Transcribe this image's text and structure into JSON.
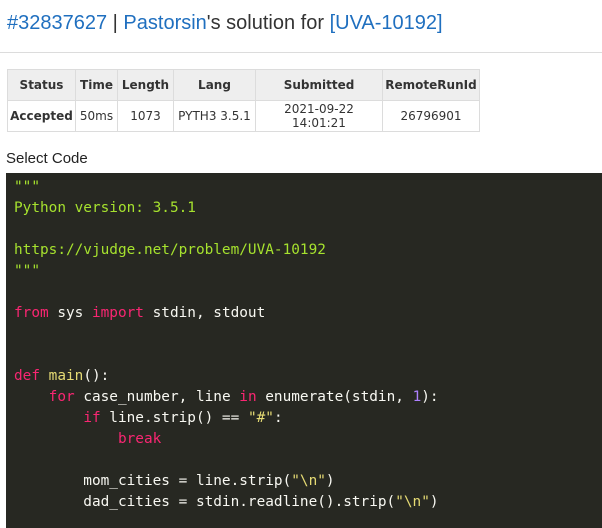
{
  "header": {
    "run_id": "#32837627",
    "separator": " | ",
    "user": "Pastorsin",
    "middle": "'s solution for ",
    "problem": "[UVA-10192]"
  },
  "table": {
    "headers": [
      "Status",
      "Time",
      "Length",
      "Lang",
      "Submitted",
      "RemoteRunId"
    ],
    "row": {
      "status": "Accepted",
      "time": "50ms",
      "length": "1073",
      "lang": "PYTH3 3.5.1",
      "submitted": "2021-09-22 14:01:21",
      "remote_run_id": "26796901"
    }
  },
  "select_code_label": "Select Code",
  "colors": {
    "link": "#1f6fbf",
    "accepted": "#3c9a3c",
    "code_background": "#272822"
  },
  "code": {
    "lines": [
      "\"\"\"",
      "Python version: 3.5.1",
      "",
      "https://vjudge.net/problem/UVA-10192",
      "\"\"\"",
      "",
      "from sys import stdin, stdout",
      "",
      "",
      "def main():",
      "    for case_number, line in enumerate(stdin, 1):",
      "        if line.strip() == \"#\":",
      "            break",
      "",
      "        mom_cities = line.strip(\"\\n\")",
      "        dad_cities = stdin.readline().strip(\"\\n\")"
    ]
  }
}
